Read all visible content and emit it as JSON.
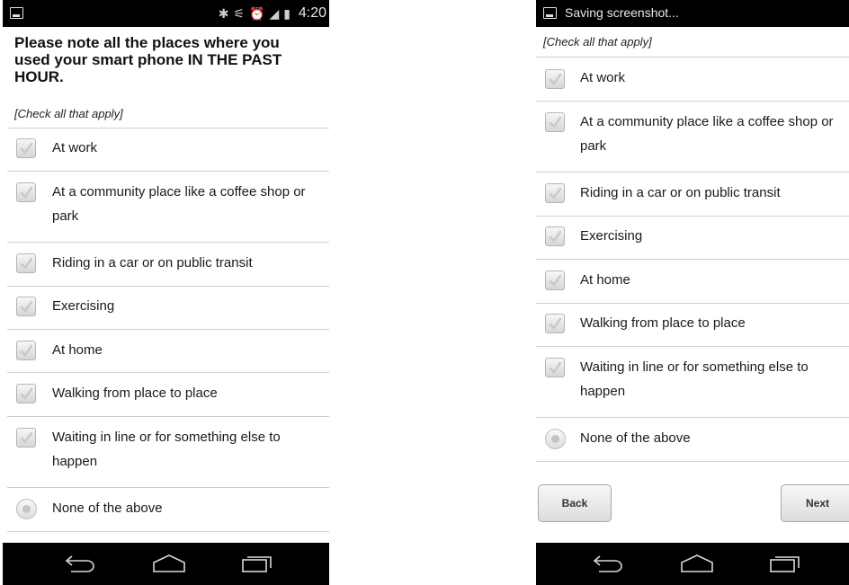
{
  "left_screen": {
    "status": {
      "time": "4:20"
    },
    "question": "Please note all the places where you used your smart phone IN THE PAST HOUR.",
    "instruction": "[Check all that apply]",
    "options": [
      {
        "label": "At work"
      },
      {
        "label": "At a community place like a coffee shop or park"
      },
      {
        "label": "Riding in a car or on public transit"
      },
      {
        "label": "Exercising"
      },
      {
        "label": "At home"
      },
      {
        "label": "Walking from place to place"
      },
      {
        "label": "Waiting in line or for something else to happen"
      },
      {
        "label": "None of the above"
      }
    ]
  },
  "right_screen": {
    "status": {
      "notification": "Saving screenshot..."
    },
    "instruction": "[Check all that apply]",
    "options": [
      {
        "label": "At work"
      },
      {
        "label": "At a community place like a coffee shop or park"
      },
      {
        "label": "Riding in a car or on public transit"
      },
      {
        "label": "Exercising"
      },
      {
        "label": "At home"
      },
      {
        "label": "Walking from place to place"
      },
      {
        "label": "Waiting in line or for something else to happen"
      },
      {
        "label": "None of the above"
      }
    ],
    "buttons": {
      "back": "Back",
      "next": "Next"
    }
  },
  "nav_icons": [
    "back-icon",
    "home-icon",
    "recent-apps-icon"
  ],
  "colors": {
    "status_bar": "#000000",
    "nav_bar": "#000000",
    "background": "#ffffff"
  }
}
